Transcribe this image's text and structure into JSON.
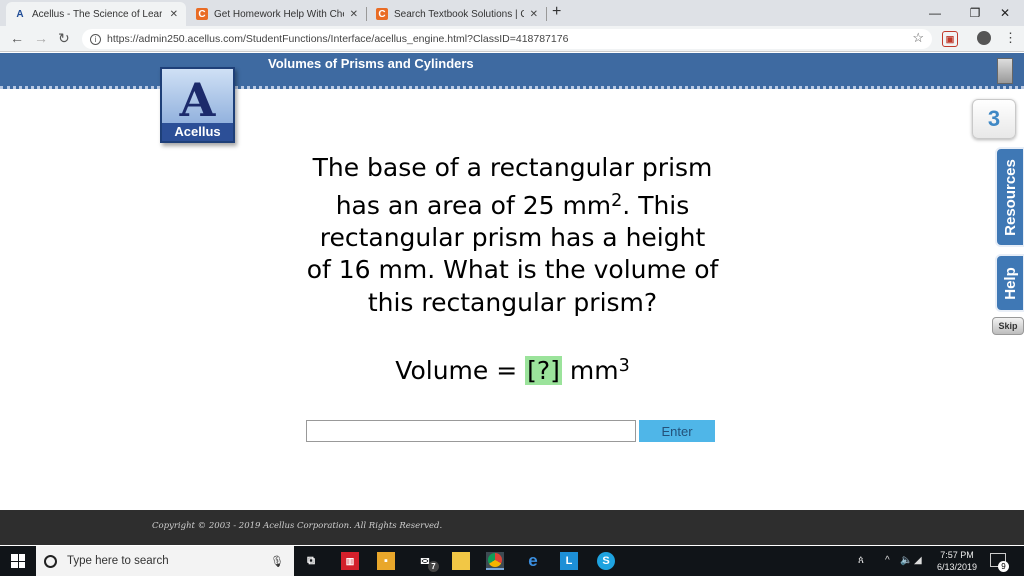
{
  "browser": {
    "tabs": [
      {
        "label": "Acellus - The Science of Learning",
        "icon": "acellus-icon"
      },
      {
        "label": "Get Homework Help With Chegg",
        "icon": "chegg-icon"
      },
      {
        "label": "Search Textbook Solutions | Chegg",
        "icon": "chegg-icon"
      }
    ],
    "url": "https://admin250.acellus.com/StudentFunctions/Interface/acellus_engine.html?ClassID=418787176",
    "extension_label": "▣"
  },
  "page": {
    "title": "Volumes of Prisms and Cylinders",
    "logo_text": "Acellus",
    "question": {
      "line1": "The base of a rectangular prism",
      "line2a": "has an area of 25 mm",
      "line2sup": "2",
      "line2b": ". This",
      "line3": "rectangular prism has a height",
      "line4": "of 16 mm. What is the volume of",
      "line5": "this rectangular prism?"
    },
    "answer": {
      "prefix": "Volume = ",
      "blank": "[?]",
      "unit": " mm",
      "unit_sup": "3"
    },
    "input_value": "",
    "enter_label": "Enter",
    "score": "3",
    "resources_label": "Resources",
    "help_label": "Help",
    "skip_label": "Skip",
    "copyright": "Copyright © 2003 - 2019 Acellus Corporation. All Rights Reserved."
  },
  "taskbar": {
    "search_placeholder": "Type here to search",
    "time": "7:57 PM",
    "date": "6/13/2019",
    "notification_count": "9",
    "mail_badge": "7"
  },
  "colors": {
    "header": "#3e6aa1",
    "side_tab": "#3f78b5",
    "enter_button": "#4fb6e8",
    "blank_highlight": "#9be39b",
    "score": "#3f88c5"
  }
}
